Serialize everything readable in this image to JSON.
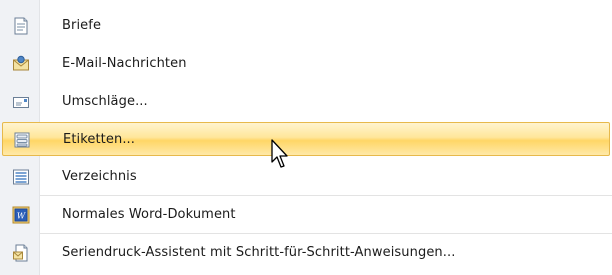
{
  "menu": {
    "items": [
      {
        "label": "Briefe",
        "icon": "letter-document-icon"
      },
      {
        "label": "E-Mail-Nachrichten",
        "icon": "email-envelope-icon"
      },
      {
        "label": "Umschläge...",
        "icon": "envelope-icon"
      },
      {
        "label": "Etiketten...",
        "icon": "labels-icon",
        "highlighted": true
      },
      {
        "label": "Verzeichnis",
        "icon": "directory-list-icon"
      },
      {
        "label": "Normales Word-Dokument",
        "icon": "word-document-icon"
      },
      {
        "label": "Seriendruck-Assistent mit Schritt-für-Schritt-Anweisungen...",
        "icon": "mail-merge-wizard-icon"
      }
    ]
  },
  "colors": {
    "highlight": "#ffd666",
    "highlight_border": "#e7b94b",
    "gutter": "#f0f2f5"
  }
}
